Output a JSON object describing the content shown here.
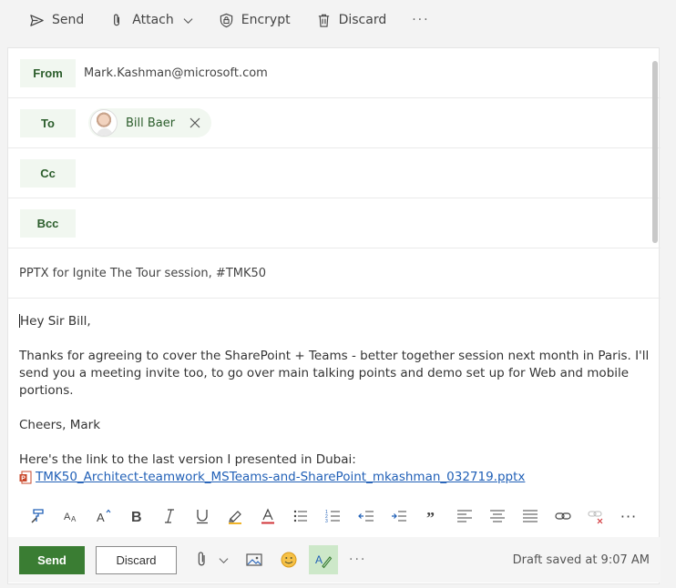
{
  "toolbar": {
    "send": "Send",
    "attach": "Attach",
    "encrypt": "Encrypt",
    "discard": "Discard",
    "more": "···"
  },
  "header": {
    "from_label": "From",
    "from_value": "Mark.Kashman@microsoft.com",
    "to_label": "To",
    "to_recipient": "Bill Baer",
    "cc_label": "Cc",
    "bcc_label": "Bcc"
  },
  "subject": "PPTX for Ignite The Tour session, #TMK50",
  "body": {
    "greeting": "Hey Sir Bill,",
    "paragraph": "Thanks for agreeing to cover the SharePoint + Teams - better together session next month in Paris. I'll send you a meeting invite too, to go over main talking points and demo set up for Web and mobile portions.",
    "signoff": "Cheers, Mark",
    "link_intro": "Here's the link to the last version I presented in Dubai:",
    "attachment_link": "TMK50_Architect-teamwork_MSTeams-and-SharePoint_mkashman_032719.pptx"
  },
  "format_more": "···",
  "footer": {
    "send": "Send",
    "discard": "Discard",
    "more": "···",
    "draft_status": "Draft saved at 9:07 AM"
  },
  "colors": {
    "accent_green": "#3a7d33",
    "field_bg": "#f1f7f0",
    "link_blue": "#2160b7"
  }
}
